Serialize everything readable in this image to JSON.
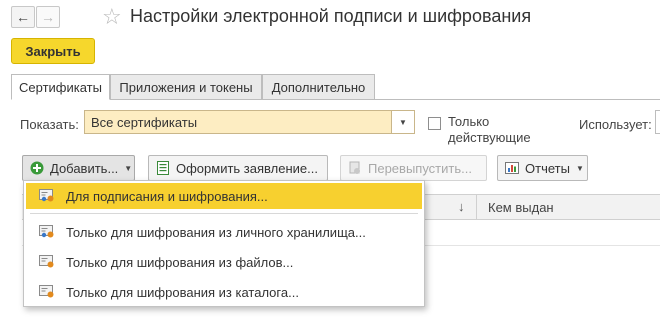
{
  "window": {
    "title": "Настройки электронной подписи и шифрования",
    "back_icon": "arrow-left-icon",
    "forward_icon": "arrow-right-icon",
    "favorite_icon": "star-icon"
  },
  "toolbar_top": {
    "close_label": "Закрыть",
    "accent_color": "#f6d72c"
  },
  "tabs": [
    {
      "label": "Сертификаты",
      "active": true
    },
    {
      "label": "Приложения и токены",
      "active": false
    },
    {
      "label": "Дополнительно",
      "active": false
    }
  ],
  "filter": {
    "show_label": "Показать:",
    "show_value": "Все сертификаты",
    "only_valid_label": "Только действующие",
    "only_valid_checked": false,
    "uses_label": "Использует:"
  },
  "toolbar": {
    "add_label": "Добавить...",
    "apply_label": "Оформить заявление...",
    "reissue_label": "Перевыпустить...",
    "reports_label": "Отчеты"
  },
  "table": {
    "sort_indicator": "↓",
    "issuer_header": "Кем выдан"
  },
  "add_menu": {
    "items": [
      {
        "label": "Для подписания и шифрования...",
        "selected": true,
        "icon": "certificate-icon"
      },
      {
        "label": "Только для шифрования из личного хранилища...",
        "selected": false,
        "icon": "certificate-icon"
      },
      {
        "label": "Только для шифрования из файлов...",
        "selected": false,
        "icon": "certificate-file-icon"
      },
      {
        "label": "Только для шифрования из каталога...",
        "selected": false,
        "icon": "certificate-file-icon"
      }
    ]
  }
}
